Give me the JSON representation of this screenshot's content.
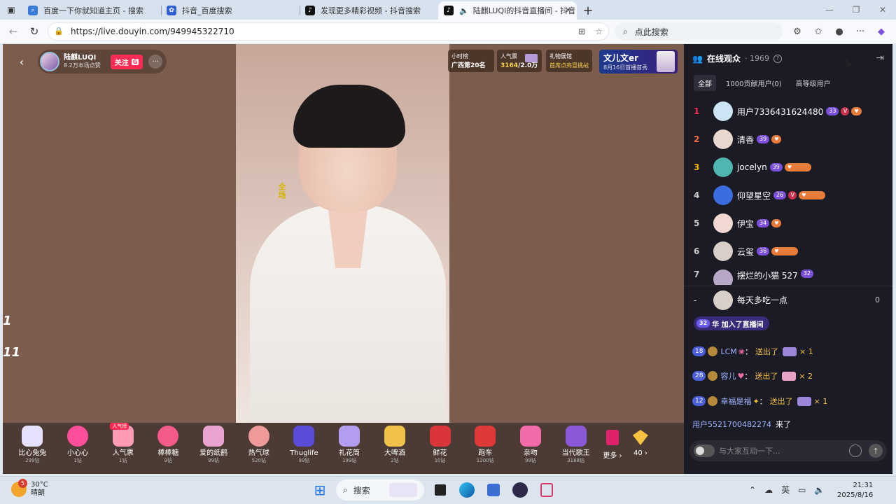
{
  "browser": {
    "tabs": [
      {
        "title": "百度一下你就知道主页 - 搜索",
        "icon": "search-icon",
        "color": "#3b7bd8"
      },
      {
        "title": "抖音_百度搜索",
        "icon": "baidu-paw-icon",
        "color": "#2f5fd0"
      },
      {
        "title": "发现更多精彩视频 - 抖音搜索",
        "icon": "douyin-icon",
        "color": "#111111"
      },
      {
        "title": "陆麒LUQI的抖音直播间 - 抖音",
        "icon": "douyin-icon",
        "color": "#111111"
      }
    ],
    "url": "https://live.douyin.com/949945322710",
    "search_placeholder": "点此搜索"
  },
  "live": {
    "anchor_name": "陆麒LUQI",
    "anchor_likes": "8.2万本场点赞",
    "follow_label": "关注",
    "follow_badge": "G",
    "more_label": "···",
    "hour_rank_title": "小时榜",
    "hour_rank_value": "广西第20名",
    "popularity_title": "人气票",
    "popularity_value": "3164",
    "popularity_total": "/2.0万",
    "gift_hall_title": "礼物展馆",
    "gift_hall_sub": "首席点亮冒挑战",
    "fan_title": "文儿文er",
    "fan_sub": "8月16日首播首秀",
    "overlay_vertical_text": "全场",
    "side_number_1": "1",
    "side_number_2": "11"
  },
  "gifts": [
    {
      "name": "比心兔兔",
      "price": "299钻",
      "color": "#e6e0ff"
    },
    {
      "name": "小心心",
      "price": "1钻",
      "color": "#ff4f9a"
    },
    {
      "name": "人气票",
      "price": "1钻",
      "color": "#ff9bb5",
      "badge": "人气榜"
    },
    {
      "name": "棒棒糖",
      "price": "9钻",
      "color": "#f35a8a"
    },
    {
      "name": "爱的纸鹤",
      "price": "99钻",
      "color": "#e8a3d0"
    },
    {
      "name": "热气球",
      "price": "520钻",
      "color": "#ef9a9a"
    },
    {
      "name": "Thuglife",
      "price": "99钻",
      "color": "#5a4bd8"
    },
    {
      "name": "礼花筒",
      "price": "199钻",
      "color": "#b39df0"
    },
    {
      "name": "大啤酒",
      "price": "2钻",
      "color": "#f1c24a"
    },
    {
      "name": "鲜花",
      "price": "10钻",
      "color": "#d9353a"
    },
    {
      "name": "跑车",
      "price": "1200钻",
      "color": "#e0393a"
    },
    {
      "name": "亲吻",
      "price": "99钻",
      "color": "#f06ba8"
    },
    {
      "name": "当代歌王",
      "price": "3188钻",
      "color": "#8c5ad9"
    }
  ],
  "gift_more": "更多",
  "gift_40": "40",
  "viewers": {
    "title": "在线观众",
    "count": "· 1969",
    "filters": [
      "全部",
      "1000贡献用户(0)",
      "高等级用户"
    ],
    "list": [
      {
        "rank": "1",
        "name": "用户7336431624480",
        "level": "33",
        "v": true,
        "color": "#cde4f5",
        "rank_color": "#fe2c55"
      },
      {
        "rank": "2",
        "name": "清香",
        "level": "39",
        "v": false,
        "color": "#e9d8cf",
        "rank_color": "#ff6a3d"
      },
      {
        "rank": "3",
        "name": "jocelyn",
        "level": "39",
        "v": false,
        "color": "#4fb6b0",
        "rank_color": "#f5b400"
      },
      {
        "rank": "4",
        "name": "仰望星空",
        "level": "26",
        "v": true,
        "color": "#3d6be0",
        "rank_color": "#cccccc"
      },
      {
        "rank": "5",
        "name": "伊宝",
        "level": "34",
        "v": false,
        "color": "#f1d8d2",
        "rank_color": "#cccccc"
      },
      {
        "rank": "6",
        "name": "云玺",
        "level": "36",
        "v": false,
        "color": "#d8cfc8",
        "rank_color": "#cccccc"
      },
      {
        "rank": "7",
        "name": "摆烂的小猫 527",
        "level": "32",
        "v": false,
        "color": "#b8a8c8",
        "rank_color": "#cccccc"
      }
    ],
    "self": {
      "rank": "-",
      "name": "每天多吃一点",
      "score": "0"
    }
  },
  "chat": {
    "join_level": "32",
    "join_text": "华 加入了直播间",
    "gift_messages": [
      {
        "level": "18",
        "name": "LCM",
        "action": "送出了",
        "count": "× 1"
      },
      {
        "level": "28",
        "name": "容儿",
        "action": "送出了",
        "count": "× 2"
      },
      {
        "level": "12",
        "name": "幸福是福",
        "action": "送出了",
        "count": "× 1"
      }
    ],
    "entry_name": "用户5521700482274",
    "entry_text": "来了",
    "input_placeholder": "与大家互动一下..."
  },
  "taskbar": {
    "temperature": "30°C",
    "weather": "晴朗",
    "weather_badge": "5",
    "search_label": "搜索",
    "ime": "英",
    "time": "21:31",
    "date": "2025/8/16"
  }
}
